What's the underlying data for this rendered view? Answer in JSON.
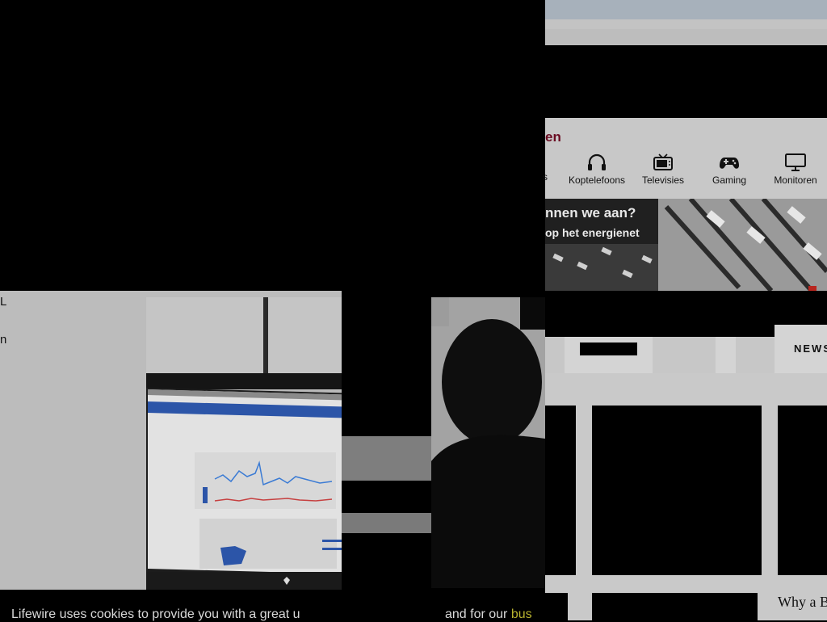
{
  "nav": {
    "title_fragment": "en",
    "partial_item": "s",
    "items": [
      {
        "label": "Koptelefoons",
        "icon": "headphones-icon"
      },
      {
        "label": "Televisies",
        "icon": "tv-icon"
      },
      {
        "label": "Gaming",
        "icon": "gamepad-icon"
      },
      {
        "label": "Monitoren",
        "icon": "monitor-icon"
      }
    ]
  },
  "hero": {
    "line1": "nnen we aan?",
    "line2": "op het energienet"
  },
  "left_card": {
    "letter_1": "L",
    "letter_2": "n"
  },
  "sections": {
    "news_label": "NEWS"
  },
  "tiles": {
    "caption": "Why a B"
  },
  "cookie": {
    "text": "Lifewire uses cookies to provide you with a great u",
    "tail": "and for our ",
    "link": "bus"
  }
}
